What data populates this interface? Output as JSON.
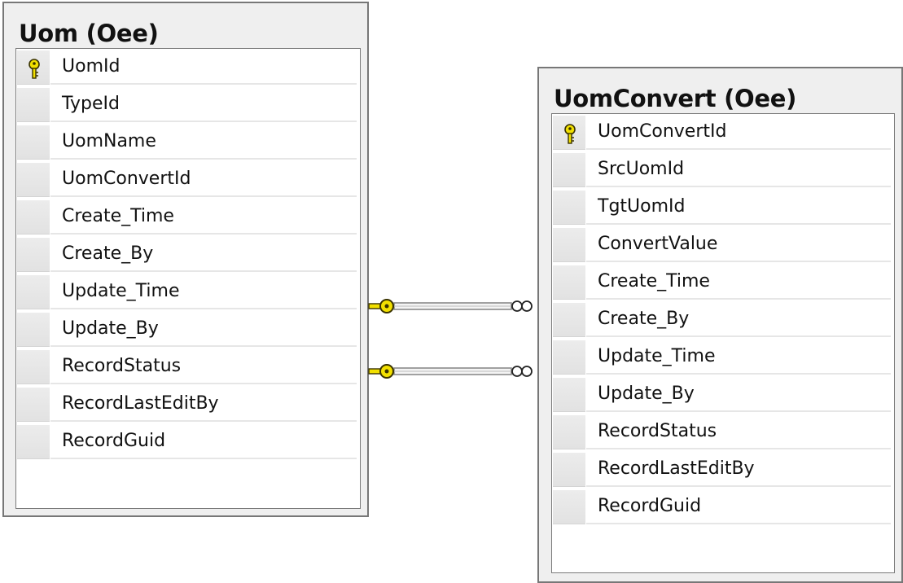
{
  "tables": {
    "uom": {
      "title": "Uom (Oee)",
      "columns": [
        {
          "name": "UomId",
          "primary_key": true
        },
        {
          "name": "TypeId",
          "primary_key": false
        },
        {
          "name": "UomName",
          "primary_key": false
        },
        {
          "name": "UomConvertId",
          "primary_key": false
        },
        {
          "name": "Create_Time",
          "primary_key": false
        },
        {
          "name": "Create_By",
          "primary_key": false
        },
        {
          "name": "Update_Time",
          "primary_key": false
        },
        {
          "name": "Update_By",
          "primary_key": false
        },
        {
          "name": "RecordStatus",
          "primary_key": false
        },
        {
          "name": "RecordLastEditBy",
          "primary_key": false
        },
        {
          "name": "RecordGuid",
          "primary_key": false
        }
      ]
    },
    "uomconvert": {
      "title": "UomConvert (Oee)",
      "columns": [
        {
          "name": "UomConvertId",
          "primary_key": true
        },
        {
          "name": "SrcUomId",
          "primary_key": false
        },
        {
          "name": "TgtUomId",
          "primary_key": false
        },
        {
          "name": "ConvertValue",
          "primary_key": false
        },
        {
          "name": "Create_Time",
          "primary_key": false
        },
        {
          "name": "Create_By",
          "primary_key": false
        },
        {
          "name": "Update_Time",
          "primary_key": false
        },
        {
          "name": "Update_By",
          "primary_key": false
        },
        {
          "name": "RecordStatus",
          "primary_key": false
        },
        {
          "name": "RecordLastEditBy",
          "primary_key": false
        },
        {
          "name": "RecordGuid",
          "primary_key": false
        }
      ]
    }
  },
  "relationships": [
    {
      "one_side": "uom",
      "many_side": "uomconvert",
      "one_end": "key-icon",
      "many_end": "infinity-icon"
    },
    {
      "one_side": "uom",
      "many_side": "uomconvert",
      "one_end": "key-icon",
      "many_end": "infinity-icon"
    }
  ],
  "colors": {
    "key": "#f2e000",
    "key_outline": "#3a3300",
    "box_fill": "#efefef",
    "box_border": "#777777",
    "line": "#8a8a8a"
  }
}
